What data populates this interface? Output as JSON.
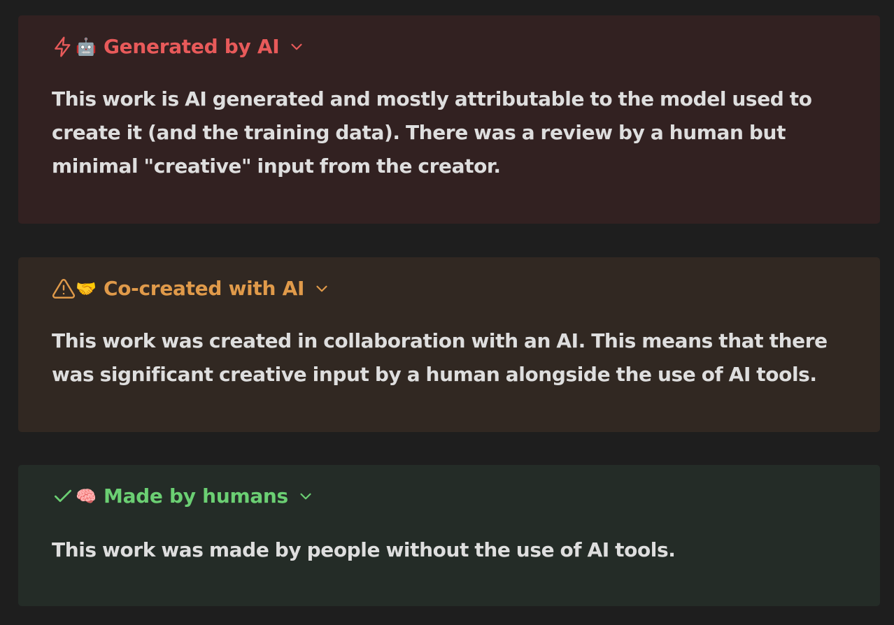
{
  "colors": {
    "background": "#1e1e1e",
    "ai_accent": "#e85a5a",
    "co_accent": "#e09a4a",
    "human_accent": "#6bcf73",
    "body_text": "#dedede"
  },
  "callouts": [
    {
      "icon": "lightning-icon",
      "emoji": "🤖",
      "emoji_name": "robot-emoji",
      "title": "Generated by AI",
      "body": "This work is AI generated and mostly attributable to the model used to create it (and the training data). There was a review by a human but minimal \"creative\" input from the creator."
    },
    {
      "icon": "warning-icon",
      "emoji": "🤝",
      "emoji_name": "handshake-emoji",
      "title": "Co-created with AI",
      "body": "This work was created in collaboration with an AI. This means that there was significant creative input by a human alongside the use of AI tools."
    },
    {
      "icon": "check-icon",
      "emoji": "🧠",
      "emoji_name": "brain-emoji",
      "title": "Made by humans",
      "body": "This work was made by people without the use of AI tools."
    }
  ]
}
